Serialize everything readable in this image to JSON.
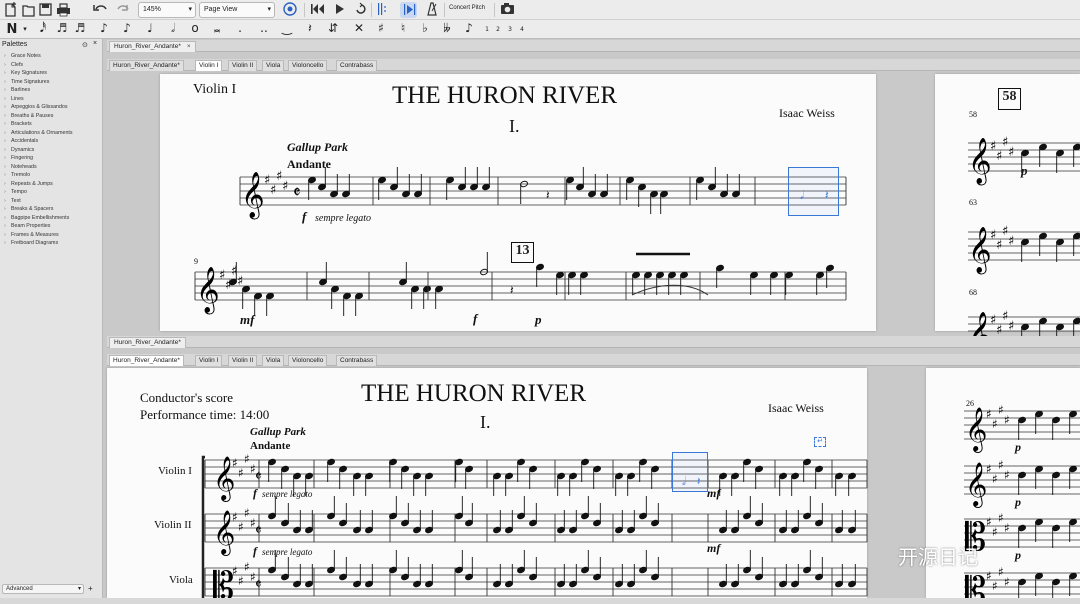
{
  "toolbar": {
    "zoom": "145%",
    "view_mode": "Page View",
    "concert_pitch_label": "Concert Pitch"
  },
  "note_toolbar": {
    "voice_numbers": [
      "1",
      "2",
      "3",
      "4"
    ]
  },
  "palettes": {
    "title": "Palettes",
    "items": [
      "Grace Notes",
      "Clefs",
      "Key Signatures",
      "Time Signatures",
      "Barlines",
      "Lines",
      "Arpeggios & Glissandos",
      "Breaths & Pauses",
      "Brackets",
      "Articulations & Ornaments",
      "Accidentals",
      "Dynamics",
      "Fingering",
      "Noteheads",
      "Tremolo",
      "Repeats & Jumps",
      "Tempo",
      "Text",
      "Breaks & Spacers",
      "Bagpipe Embellishments",
      "Beam Properties",
      "Frames & Measures",
      "Fretboard Diagrams"
    ],
    "workspace": "Advanced"
  },
  "top_pane": {
    "file_tab": "Huron_River_Andante*",
    "part_tabs": [
      "Huron_River_Andante*",
      "Violin I",
      "Violin II",
      "Viola",
      "Violoncello",
      "Contrabass"
    ],
    "active_part": 1,
    "part_name": "Violin I",
    "title": "THE HURON RIVER",
    "movement": "I.",
    "composer": "Isaac Weiss",
    "location_text": "Gallup Park",
    "tempo_text": "Andante",
    "dynamic_1": "f",
    "expression_1": "sempre legato",
    "measure_number_9": "9",
    "rehearsal_13": "13",
    "dynamic_mf": "mf",
    "dynamic_f": "f",
    "dynamic_p": "p",
    "side_rehearsal_58": "58",
    "side_measure_58": "58",
    "side_measure_63": "63",
    "side_measure_68": "68",
    "side_dynamic_p": "p"
  },
  "bottom_pane": {
    "file_tab": "Huron_River_Andante*",
    "part_tabs": [
      "Huron_River_Andante*",
      "Violin I",
      "Violin II",
      "Viola",
      "Violoncello",
      "Contrabass"
    ],
    "active_part": 0,
    "score_label": "Conductor's score",
    "performance_time": "Performance time: 14:00",
    "title": "THE HURON RIVER",
    "movement": "I.",
    "composer": "Isaac Weiss",
    "location_text": "Gallup Park",
    "tempo_text": "Andante",
    "instruments": [
      "Violin I",
      "Violin II",
      "Viola"
    ],
    "dynamic_1": "f",
    "expression_1": "sempre legato",
    "dynamic_2": "f",
    "expression_2": "sempre legato",
    "dynamic_mf_1": "mf",
    "dynamic_mf_2": "mf",
    "side_measure_26": "26",
    "side_dynamic_p1": "p",
    "side_dynamic_p2": "p",
    "side_dynamic_p3": "p"
  },
  "watermark": "开源日记",
  "colors": {
    "selection": "#3a78d8",
    "toolbar_bg": "#ececec",
    "page_bg": "#fbfbfb"
  }
}
